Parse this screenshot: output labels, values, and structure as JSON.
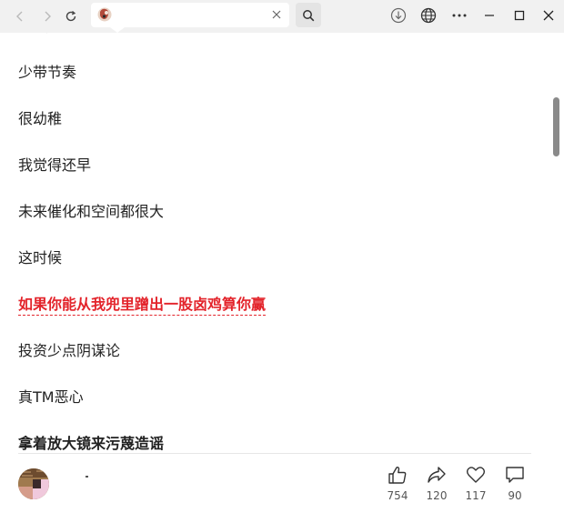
{
  "browser": {
    "toolbar_icons": [
      "back-icon",
      "forward-icon",
      "refresh-icon",
      "close-icon",
      "search-icon",
      "download-icon",
      "globe-icon",
      "more-icon",
      "minimize-icon",
      "maximize-icon",
      "close-window-icon"
    ]
  },
  "article": {
    "lines": [
      {
        "text": "少带节奏",
        "style": "normal"
      },
      {
        "text": "很幼稚",
        "style": "normal"
      },
      {
        "text": "我觉得还早",
        "style": "normal"
      },
      {
        "text": "未来催化和空间都很大",
        "style": "normal"
      },
      {
        "text": "这时候",
        "style": "normal"
      },
      {
        "text": "如果你能从我兜里蹭出一股卤鸡算你赢",
        "style": "red-bold-underline"
      },
      {
        "text": "投资少点阴谋论",
        "style": "normal"
      },
      {
        "text": "真TM恶心",
        "style": "normal"
      },
      {
        "text": "拿着放大镜来污蔑造谣",
        "style": "bold"
      }
    ],
    "highlight_color": "#e3242b"
  },
  "actions": {
    "like_count": "754",
    "share_count": "120",
    "favorite_count": "117",
    "comment_count": "90"
  }
}
